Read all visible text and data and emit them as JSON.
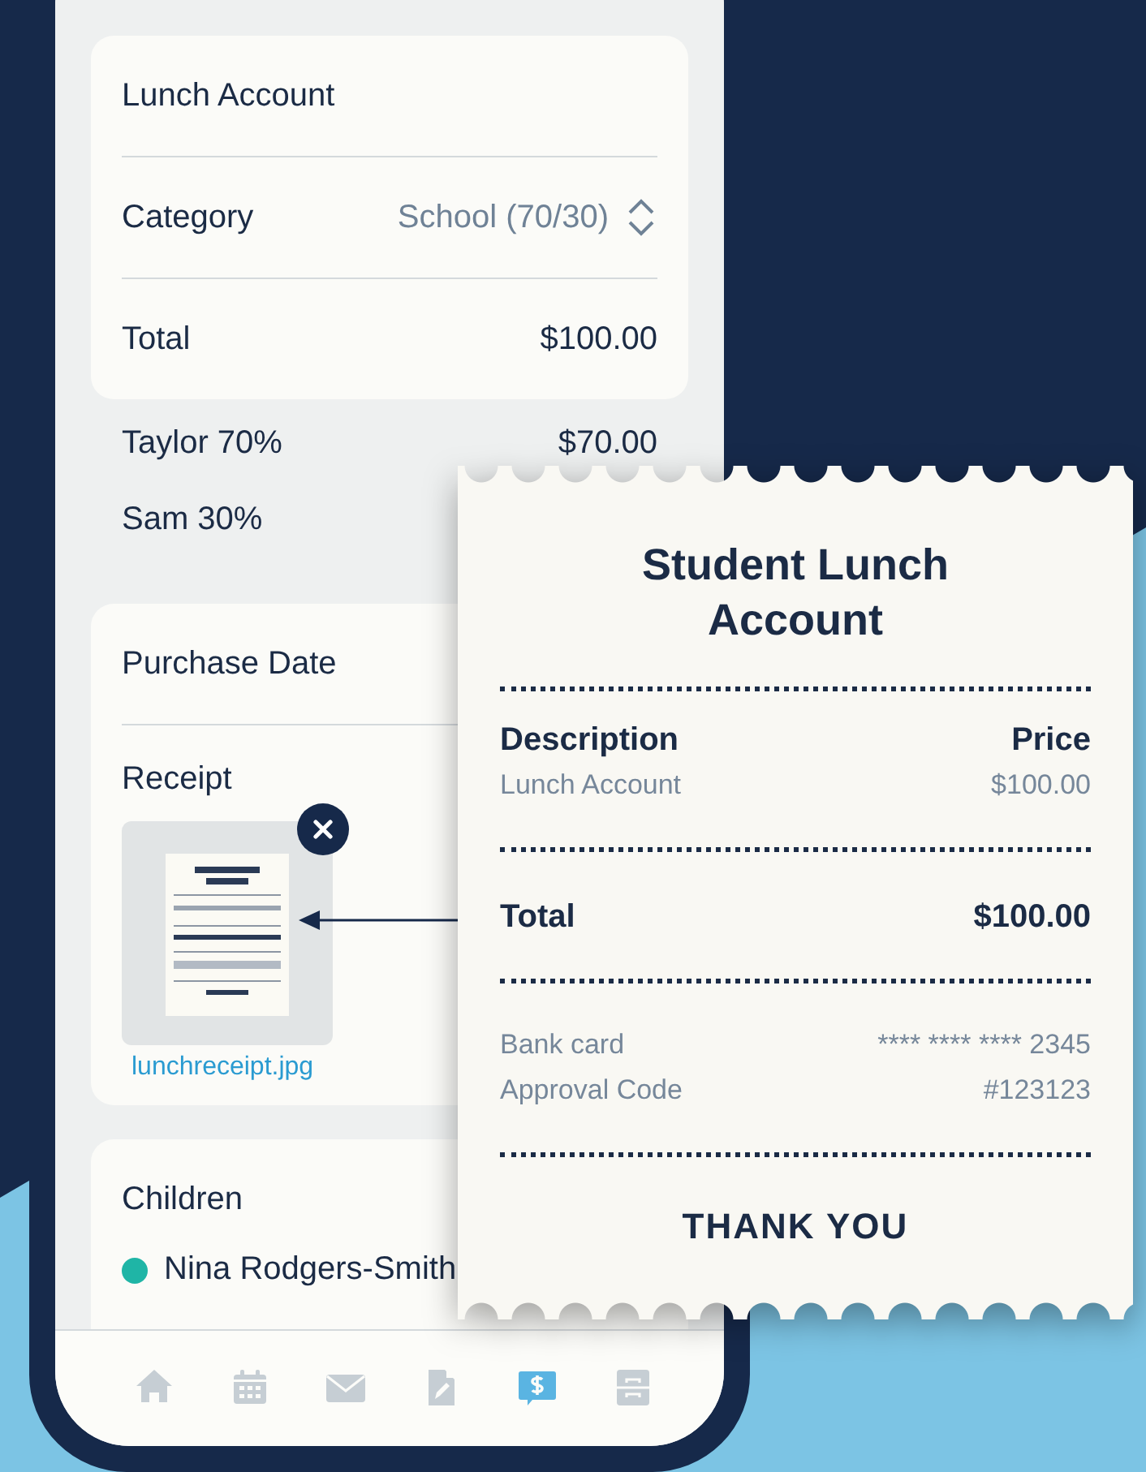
{
  "account_card": {
    "rows": [
      {
        "kind": "title",
        "label": "Lunch Account"
      },
      {
        "kind": "select",
        "label": "Category",
        "value": "School (70/30)"
      },
      {
        "kind": "value",
        "label": "Total",
        "value": "$100.00"
      }
    ]
  },
  "split": [
    {
      "label": "Taylor 70%",
      "amount": "$70.00"
    },
    {
      "label": "Sam 30%"
    }
  ],
  "details_card": {
    "purchase_date": {
      "label": "Purchase Date"
    },
    "receipt": {
      "label": "Receipt",
      "file_name": "lunchreceipt.jpg"
    }
  },
  "children_card": {
    "title": "Children",
    "children": [
      {
        "name": "Nina Rodgers-Smith",
        "color": "#1fb5a6"
      }
    ]
  },
  "tab_bar": [
    {
      "kind": "home",
      "selected": false
    },
    {
      "kind": "calendar",
      "selected": false
    },
    {
      "kind": "mail",
      "selected": false
    },
    {
      "kind": "document",
      "selected": false
    },
    {
      "kind": "payment",
      "selected": true
    },
    {
      "kind": "cabinet",
      "selected": false
    }
  ],
  "receipt": {
    "title": "Student Lunch Account",
    "columns": [
      "Description",
      "Price"
    ],
    "item": {
      "label": "Lunch Account",
      "price": "$100.00"
    },
    "total": {
      "label": "Total",
      "amount": "$100.00"
    },
    "payment": [
      {
        "label": "Bank card",
        "value": "**** **** **** 2345"
      },
      {
        "label": "Approval Code",
        "value": "#123123"
      }
    ],
    "footer": "THANK YOU"
  }
}
